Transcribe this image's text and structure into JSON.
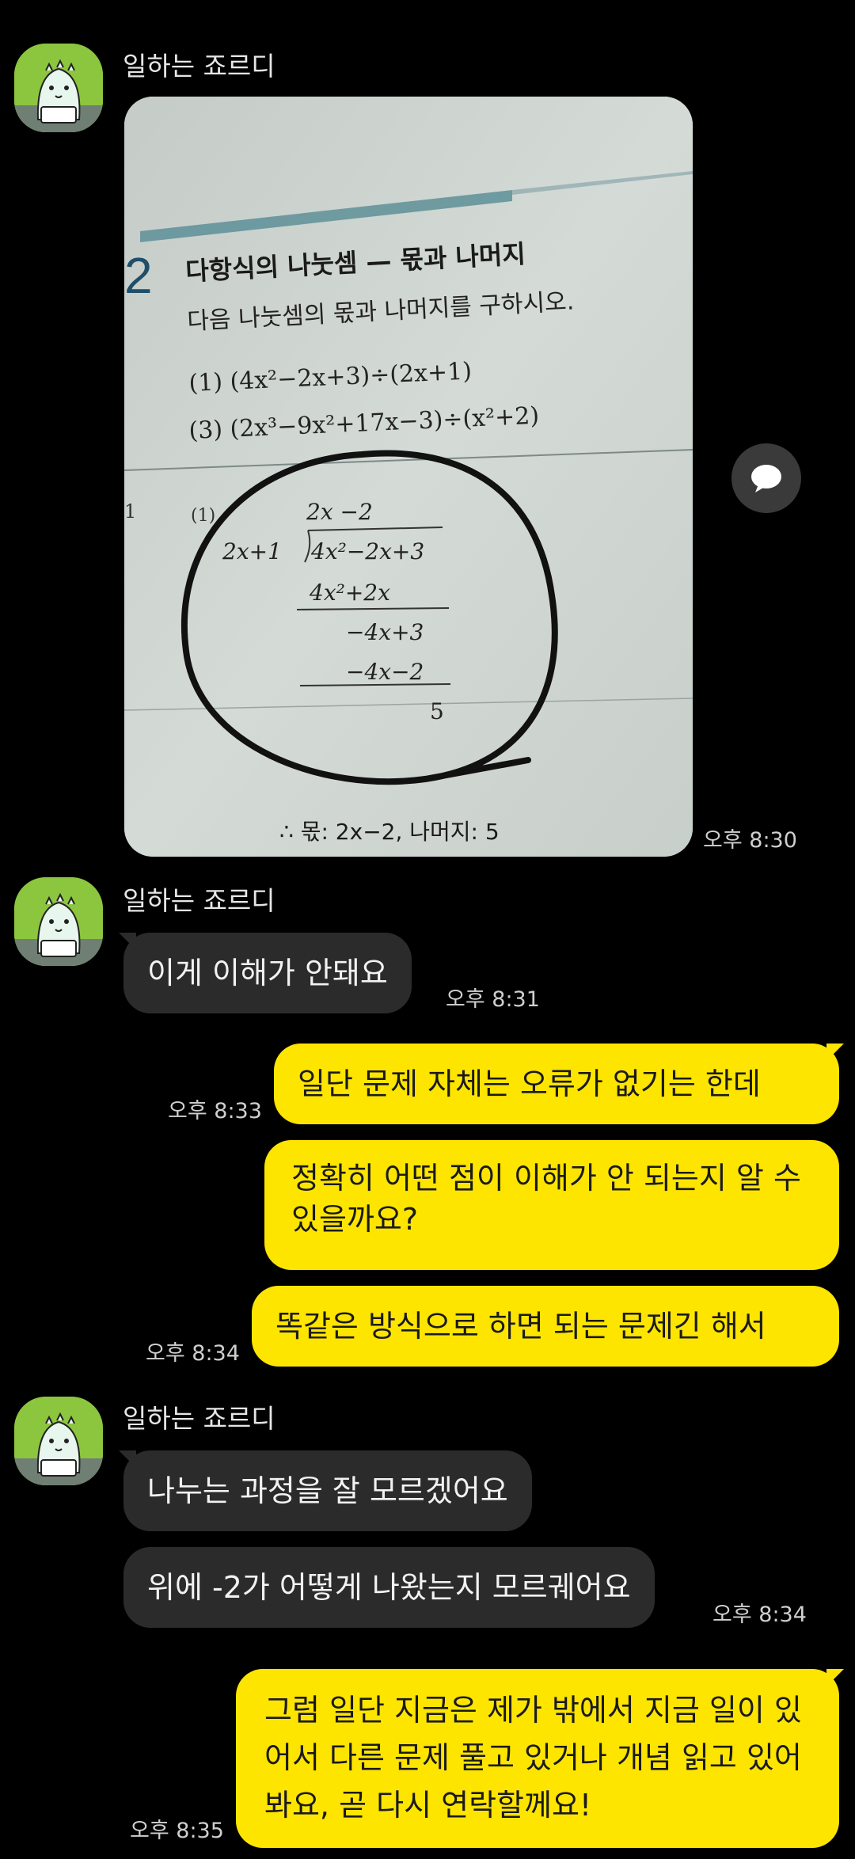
{
  "messages": {
    "m1": {
      "sender": "일하는 죠르디",
      "time": "오후 8:30"
    },
    "m2": {
      "sender": "일하는 죠르디",
      "text": "이게 이해가 안돼요",
      "time": "오후 8:31"
    },
    "m3": {
      "text": "일단 문제 자체는 오류가 없기는 한데",
      "time": "오후 8:33"
    },
    "m4": {
      "text": "정확히 어떤 점이 이해가 안 되는지 알 수 있을까요?"
    },
    "m5": {
      "text": "똑같은 방식으로 하면 되는 문제긴 해서",
      "time": "오후 8:34"
    },
    "m6": {
      "sender": "일하는 죠르디",
      "text": "나누는 과정을 잘 모르겠어요"
    },
    "m7": {
      "text": "위에 -2가 어떻게 나왔는지 모르궤어요",
      "time": "오후 8:34"
    },
    "m8": {
      "text": "그럼 일단 지금은 제가 밖에서 지금 일이 있어서 다른 문제 풀고 있거나 개념 읽고 있어봐요, 곧 다시 연락할께요!",
      "time": "오후 8:35"
    }
  },
  "photo": {
    "section_number": "2",
    "heading": "다항식의 나눗셈 — 몫과 나머지",
    "instruction": "다음 나눗셈의 몫과 나머지를 구하시오.",
    "problem1": "(1) (4x²−2x+3)÷(2x+1)",
    "problem3": "(3) (2x³−9x²+17x−3)÷(x²+2)",
    "left_marker": "1",
    "sol_label": "(1)",
    "quotient": "2x −2",
    "divisor": "2x+1",
    "dividend": "4x²−2x+3",
    "step1": "4x²+2x",
    "step2": "−4x+3",
    "step3": "−4x−2",
    "remainder": "5",
    "answer": "∴ 몫: 2x−2, 나머지: 5"
  },
  "colors": {
    "background": "#000000",
    "incoming_bubble": "#2b2b2b",
    "outgoing_bubble": "#fee500",
    "avatar": "#8cc63f"
  },
  "icons": {
    "avatar": "jordy-character-icon",
    "share": "speech-bubble-icon"
  }
}
